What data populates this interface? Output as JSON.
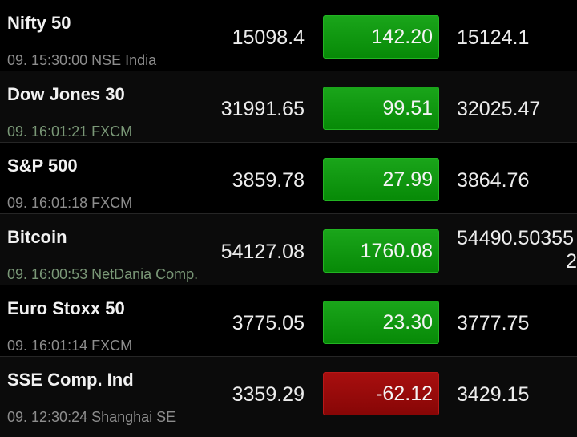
{
  "rows": [
    {
      "name": "Nifty 50",
      "time": "09. 15:30:00",
      "source": "NSE India",
      "price": "15098.4",
      "change": "142.20",
      "direction": "up",
      "last": "15124.1",
      "last_line2": ""
    },
    {
      "name": "Dow Jones 30",
      "time": "09. 16:01:21",
      "source": "FXCM",
      "price": "31991.65",
      "change": "99.51",
      "direction": "up",
      "last": "32025.47",
      "last_line2": ""
    },
    {
      "name": "S&P 500",
      "time": "09. 16:01:18",
      "source": "FXCM",
      "price": "3859.78",
      "change": "27.99",
      "direction": "up",
      "last": "3864.76",
      "last_line2": ""
    },
    {
      "name": "Bitcoin",
      "time": "09. 16:00:53",
      "source": "NetDania Comp.",
      "price": "54127.08",
      "change": "1760.08",
      "direction": "up",
      "last": "54490.50355",
      "last_line2": "2"
    },
    {
      "name": "Euro Stoxx 50",
      "time": "09. 16:01:14",
      "source": "FXCM",
      "price": "3775.05",
      "change": "23.30",
      "direction": "up",
      "last": "3777.75",
      "last_line2": ""
    },
    {
      "name": "SSE Comp. Ind",
      "time": "09. 12:30:24",
      "source": "Shanghai SE",
      "price": "3359.29",
      "change": "-62.12",
      "direction": "down",
      "last": "3429.15",
      "last_line2": ""
    }
  ],
  "colors": {
    "up": "#0f990f",
    "down": "#980a0a",
    "meta_closed": "#8d8d8d",
    "meta_live": "#7a9877"
  }
}
